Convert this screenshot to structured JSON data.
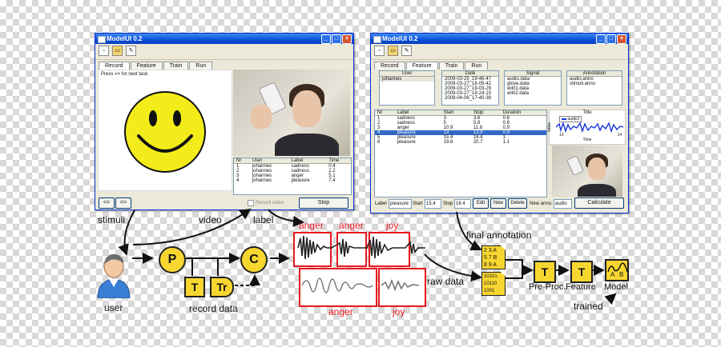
{
  "win1": {
    "title": "ModelUI 0.2",
    "tabs": [
      "Record",
      "Feature",
      "Train",
      "Run"
    ],
    "prompt": "Press => for next task",
    "table": {
      "headers": [
        "Nr",
        "User",
        "Label",
        "Time"
      ],
      "rows": [
        [
          "1",
          "johannes",
          "sadness",
          "0.4"
        ],
        [
          "2",
          "johannes",
          "sadness",
          "2.2"
        ],
        [
          "3",
          "johannes",
          "anger",
          "5.1"
        ],
        [
          "4",
          "johannes",
          "pleasure",
          "7.4"
        ]
      ]
    },
    "prev_btn": "<=",
    "next_btn": "=>",
    "record_video": "Record video",
    "stop_btn": "Stop"
  },
  "win2": {
    "title": "ModelUI 0.2",
    "tabs": [
      "Record",
      "Feature",
      "Train",
      "Run"
    ],
    "user_header": "User",
    "users": [
      "johannes"
    ],
    "date_header": "Date",
    "dates": [
      "2009-03-25_19-46-47",
      "2009-03-27_18-05-42",
      "2009-03-27_19-03-29",
      "2009-03-27_19-24-10",
      "2009-04-06_17-40-38"
    ],
    "signal_header": "Signal",
    "signals": [
      "audio.data",
      "glove.data",
      "wii01.data",
      "wii02.data"
    ],
    "annotation_header": "Annotation",
    "annotations": [
      "audio.anno",
      "stimuli.anno"
    ],
    "table": {
      "headers": [
        "Nr",
        "Label",
        "Start",
        "Stop",
        "Duration"
      ],
      "rows": [
        [
          "1",
          "sadness",
          "3",
          "3.6",
          "0.6"
        ],
        [
          "2",
          "sadness",
          "5",
          "5.8",
          "0.8"
        ],
        [
          "3",
          "anger",
          "10.9",
          "11.8",
          "0.9"
        ],
        [
          "4",
          "pleasure",
          "13",
          "13.9",
          "0.9"
        ],
        [
          "5",
          "pleasure",
          "15.4",
          "16.4",
          "1"
        ],
        [
          "6",
          "pleasure",
          "19.6",
          "20.7",
          "1.1"
        ]
      ],
      "selected_row": 3
    },
    "plot": {
      "title": "Title",
      "legend": "audio1",
      "ylabel": "Value",
      "xlabel": "Time",
      "tick_left": "13",
      "tick_right": "14"
    },
    "form": {
      "label_caption": "Label",
      "label_value": "pleasure",
      "start_caption": "Start",
      "start_value": "15.4",
      "stop_caption": "Stop",
      "stop_value": "16.4",
      "edit_btn": "Edit",
      "new_btn": "New",
      "delete_btn": "Delete",
      "new_anno_caption": "New anno:",
      "new_anno_value": "audio",
      "calculate_btn": "Calculate"
    }
  },
  "diagram": {
    "stimuli": "stimuli",
    "video": "video",
    "label": "label",
    "user": "user",
    "p_node": "P",
    "c_node": "C",
    "t_node": "T",
    "tr_node": "Tr",
    "record_data": "record data",
    "anger_top": "anger",
    "anger_mid": "anger",
    "joy_top": "joy",
    "anger_bottom": "anger",
    "joy_bottom": "joy",
    "raw_data": "raw data",
    "final_annotation": "final annotation",
    "anno_doc_lines": [
      "2 3 A",
      "5 7 B",
      "8 9 A"
    ],
    "data_doc_lines": [
      "10101",
      "10110",
      "1001"
    ],
    "preproc_block": "T",
    "preproc_label": "Pre-Proc.",
    "feature_block": "T",
    "feature_label": "Feature",
    "model_label": "Model",
    "model_ab": [
      "A",
      "B"
    ],
    "trained": "trained"
  },
  "colors": {
    "accent_red": "#e8181e",
    "block_yellow": "#f8d630",
    "xp_blue": "#0a4fd8"
  }
}
